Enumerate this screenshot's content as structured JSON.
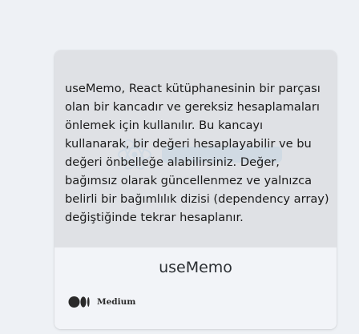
{
  "card": {
    "description": "useMemo, React kütüphanesinin bir parçası olan bir kancadır ve gereksiz hesaplamaları önlemek için kullanılır. Bu kancayı kullanarak, bir değeri hesaplayabilir ve bu değeri önbelleğe alabilirsiniz. Değer, bağımsız olarak güncellenmez ve yalnızca belirli bir bağımlılık dizisi (dependency array) değiştiğinde tekrar hesaplanır.",
    "title": "useMemo",
    "source": {
      "name": "Medium",
      "icon": "medium-logo-icon"
    }
  }
}
